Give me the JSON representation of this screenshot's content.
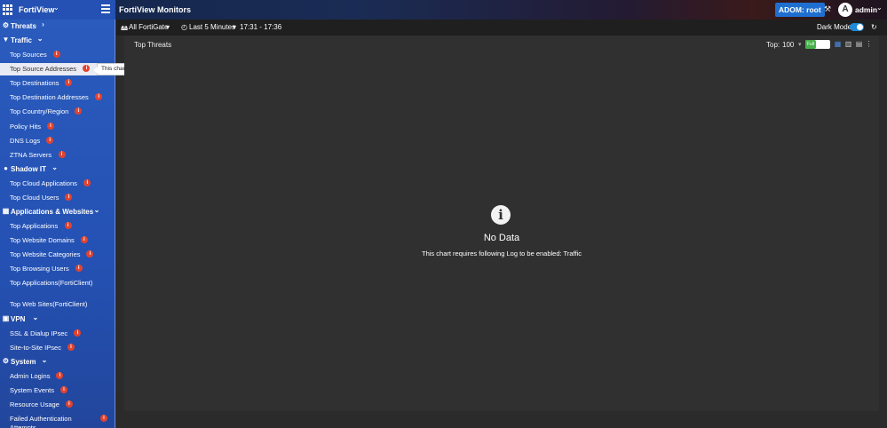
{
  "app": {
    "brand": "FortiView",
    "tabs": [
      {
        "label": "FortiView"
      },
      {
        "label": "Monitors"
      }
    ],
    "adom": "ADOM: root",
    "user": {
      "initial": "A",
      "name": "admin"
    }
  },
  "sidebar": {
    "sections": [
      {
        "label": "Threats",
        "icon": "bug-icon",
        "items": []
      },
      {
        "label": "Traffic",
        "icon": "filter-icon",
        "items": [
          {
            "label": "Top Sources",
            "warn": true
          },
          {
            "label": "Top Source Addresses",
            "warn": true,
            "active": true
          },
          {
            "label": "Top Destinations",
            "warn": true
          },
          {
            "label": "Top Destination Addresses",
            "warn": true
          },
          {
            "label": "Top Country/Region",
            "warn": true
          },
          {
            "label": "Policy Hits",
            "warn": true
          },
          {
            "label": "DNS Logs",
            "warn": true
          },
          {
            "label": "ZTNA Servers",
            "warn": true
          }
        ]
      },
      {
        "label": "Shadow IT",
        "icon": "lightbulb-icon",
        "items": [
          {
            "label": "Top Cloud Applications",
            "warn": true
          },
          {
            "label": "Top Cloud Users",
            "warn": true
          }
        ]
      },
      {
        "label": "Applications & Websites",
        "icon": "apps-grid-icon",
        "items": [
          {
            "label": "Top Applications",
            "warn": true
          },
          {
            "label": "Top Website Domains",
            "warn": true
          },
          {
            "label": "Top Website Categories",
            "warn": true
          },
          {
            "label": "Top Browsing Users",
            "warn": true
          },
          {
            "label": "Top Applications(FortiClient)",
            "warn": false
          },
          {
            "label": "Top Web Sites(FortiClient)",
            "warn": false
          }
        ]
      },
      {
        "label": "VPN",
        "icon": "lock-icon",
        "items": [
          {
            "label": "SSL & Dialup IPsec",
            "warn": true
          },
          {
            "label": "Site-to-Site IPsec",
            "warn": true
          }
        ]
      },
      {
        "label": "System",
        "icon": "settings-icon",
        "items": [
          {
            "label": "Admin Logins",
            "warn": true
          },
          {
            "label": "System Events",
            "warn": true
          },
          {
            "label": "Resource Usage",
            "warn": true
          },
          {
            "label": "Failed Authentication Attempts",
            "warn": true
          }
        ]
      }
    ]
  },
  "tooltip": "This chart requires following Log to be enabled: Traffic",
  "toolbar": {
    "device": "All FortiGate",
    "time_range": "Last 5 Minutes",
    "time_window": "17:31 - 17:36",
    "dark_mode_label": "Dark Mode"
  },
  "panel": {
    "title": "Top Threats",
    "top_label": "Top:",
    "top_value": "100",
    "full_label": "Full",
    "nodata_icon": "i",
    "nodata_title": "No Data",
    "nodata_message": "This chart requires following Log to be enabled: Traffic"
  },
  "colors": {
    "sidebar_blue": "#2451b3",
    "warning_red": "#e2432f",
    "adom_blue": "#1f6fd0",
    "panel_bg": "#303030"
  }
}
